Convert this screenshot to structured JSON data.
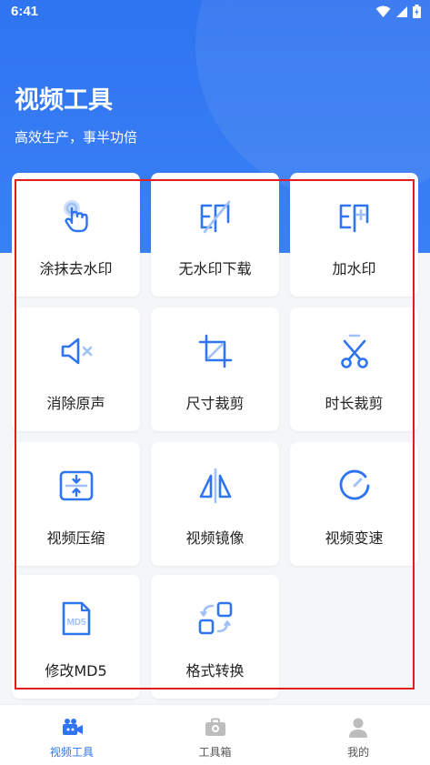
{
  "status_bar": {
    "time": "6:41",
    "icons": [
      "wifi-icon",
      "signal-icon",
      "battery-icon"
    ]
  },
  "header": {
    "title": "视频工具",
    "subtitle": "高效生产，事半功倍"
  },
  "tools": [
    {
      "label": "涂抹去水印",
      "icon": "finger-tap-icon"
    },
    {
      "label": "无水印下载",
      "icon": "no-watermark-icon"
    },
    {
      "label": "加水印",
      "icon": "add-watermark-icon"
    },
    {
      "label": "消除原声",
      "icon": "mute-icon"
    },
    {
      "label": "尺寸裁剪",
      "icon": "crop-icon"
    },
    {
      "label": "时长裁剪",
      "icon": "scissors-icon"
    },
    {
      "label": "视频压缩",
      "icon": "compress-icon"
    },
    {
      "label": "视频镜像",
      "icon": "mirror-icon"
    },
    {
      "label": "视频变速",
      "icon": "speed-icon"
    },
    {
      "label": "修改MD5",
      "icon": "md5-file-icon"
    },
    {
      "label": "格式转换",
      "icon": "format-convert-icon"
    }
  ],
  "bottom_nav": [
    {
      "label": "视频工具",
      "icon": "video-camera-icon",
      "active": true
    },
    {
      "label": "工具箱",
      "icon": "toolbox-icon",
      "active": false
    },
    {
      "label": "我的",
      "icon": "user-icon",
      "active": false
    }
  ],
  "colors": {
    "primary": "#2f74f0",
    "highlight_box": "#e11d1d",
    "icon_light": "#9fc0f8"
  }
}
